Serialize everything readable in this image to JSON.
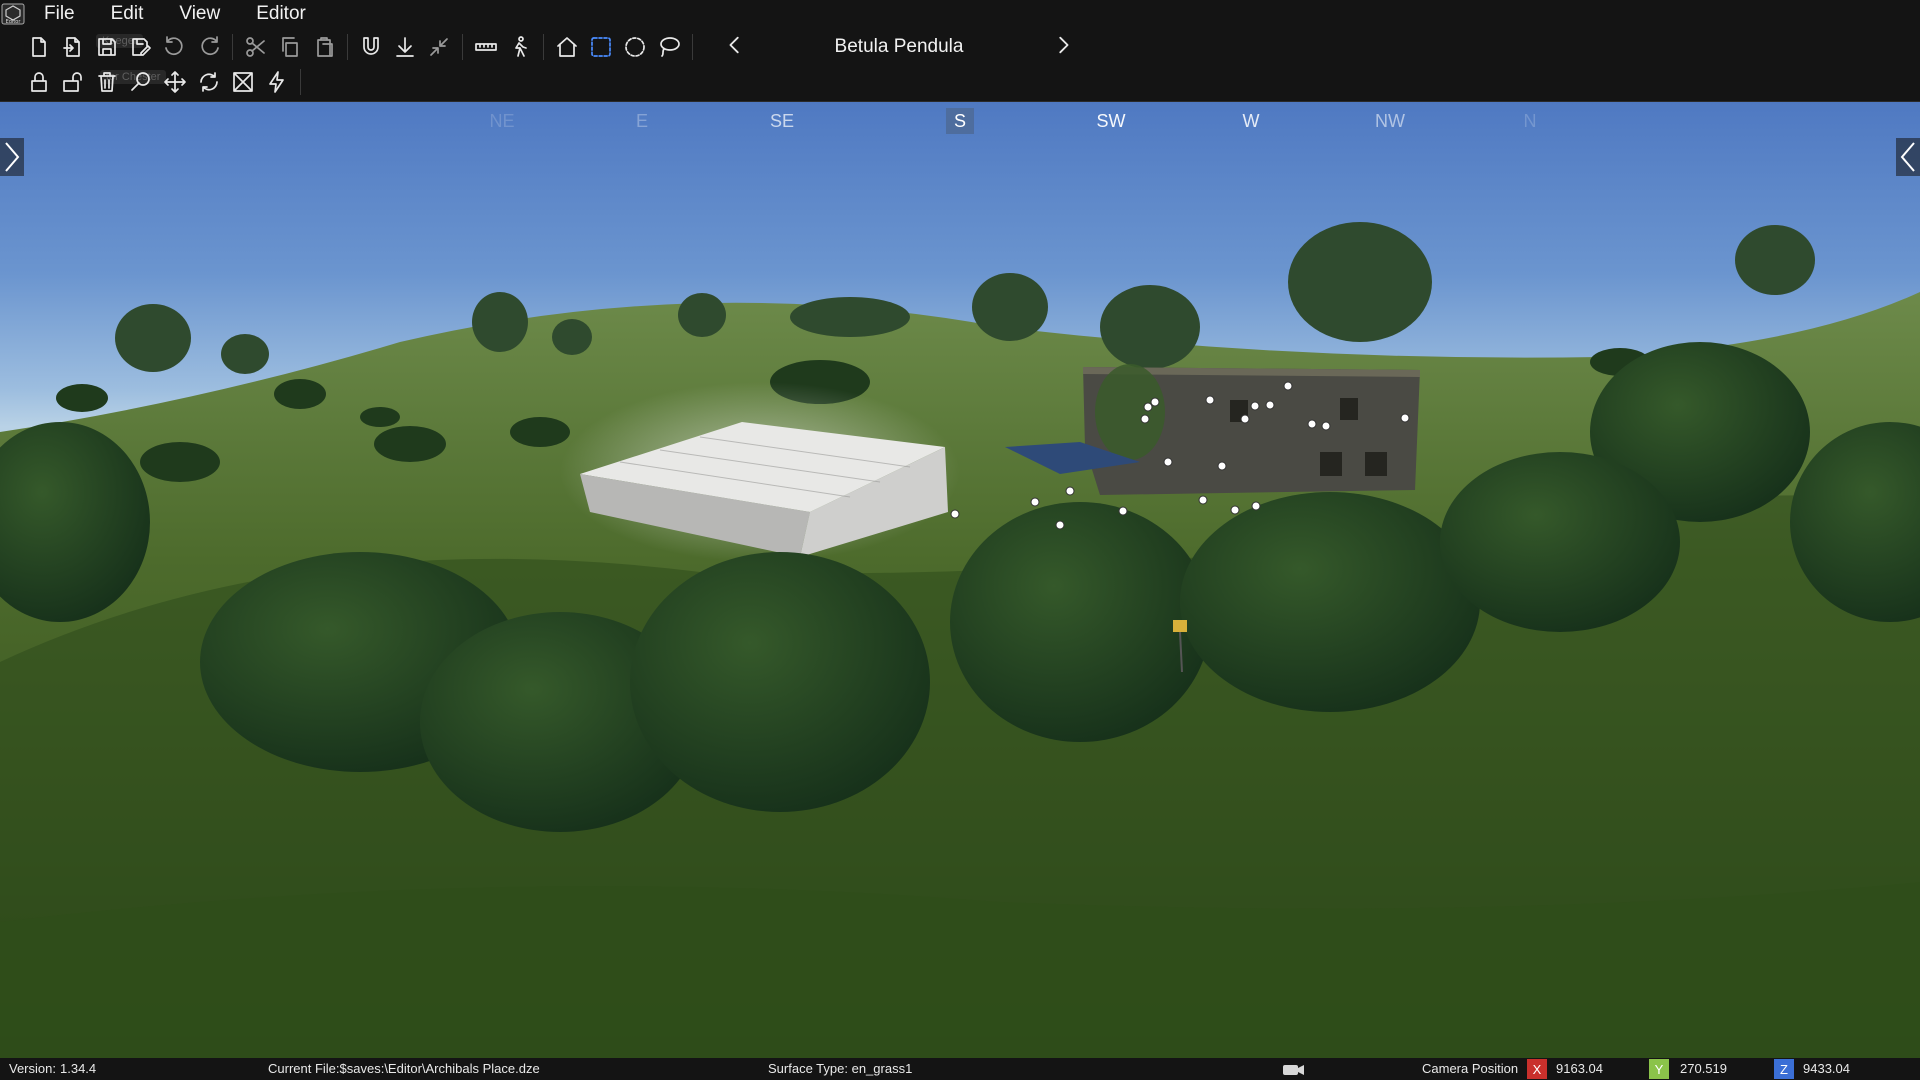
{
  "app": {
    "logo_text": "Editor"
  },
  "menu": {
    "items": [
      "File",
      "Edit",
      "View",
      "Editor"
    ]
  },
  "toolbar": {
    "selected_object": "Betula Pendula",
    "ghost_text_1": "Kaeger",
    "ghost_text_2": "tor Chester",
    "row1_icons": [
      "new-file-icon",
      "open-file-icon",
      "save-icon",
      "save-as-icon",
      "undo-icon",
      "redo-icon",
      "cut-icon",
      "copy-icon",
      "paste-icon",
      "magnet-icon",
      "snap-ground-icon",
      "collapse-icon",
      "measure-icon",
      "walk-icon",
      "home-icon",
      "box-select-icon",
      "circle-select-icon",
      "lasso-select-icon"
    ],
    "row2_icons": [
      "lock-icon",
      "unlock-icon",
      "delete-icon",
      "search-icon",
      "move-icon",
      "rotate-icon",
      "scale-icon",
      "lightning-icon"
    ],
    "active_color": "#4a8cff"
  },
  "compass": {
    "labels": [
      "NE",
      "E",
      "SE",
      "S",
      "SW",
      "W",
      "NW",
      "N"
    ],
    "active": "S",
    "active_color": "#4e6d9e"
  },
  "status": {
    "version_label": "Version:",
    "version": "1.34.4",
    "current_file": "Current File:$saves:\\Editor\\Archibals Place.dze",
    "surface_type": "Surface Type: en_grass1",
    "camera_label": "Camera Position",
    "x_label": "X",
    "x": "9163.04",
    "y_label": "Y",
    "y": "270.519",
    "z_label": "Z",
    "z": "9433.04",
    "x_color": "#c9302c",
    "y_color": "#8bc34a",
    "z_color": "#3b6fd6"
  }
}
